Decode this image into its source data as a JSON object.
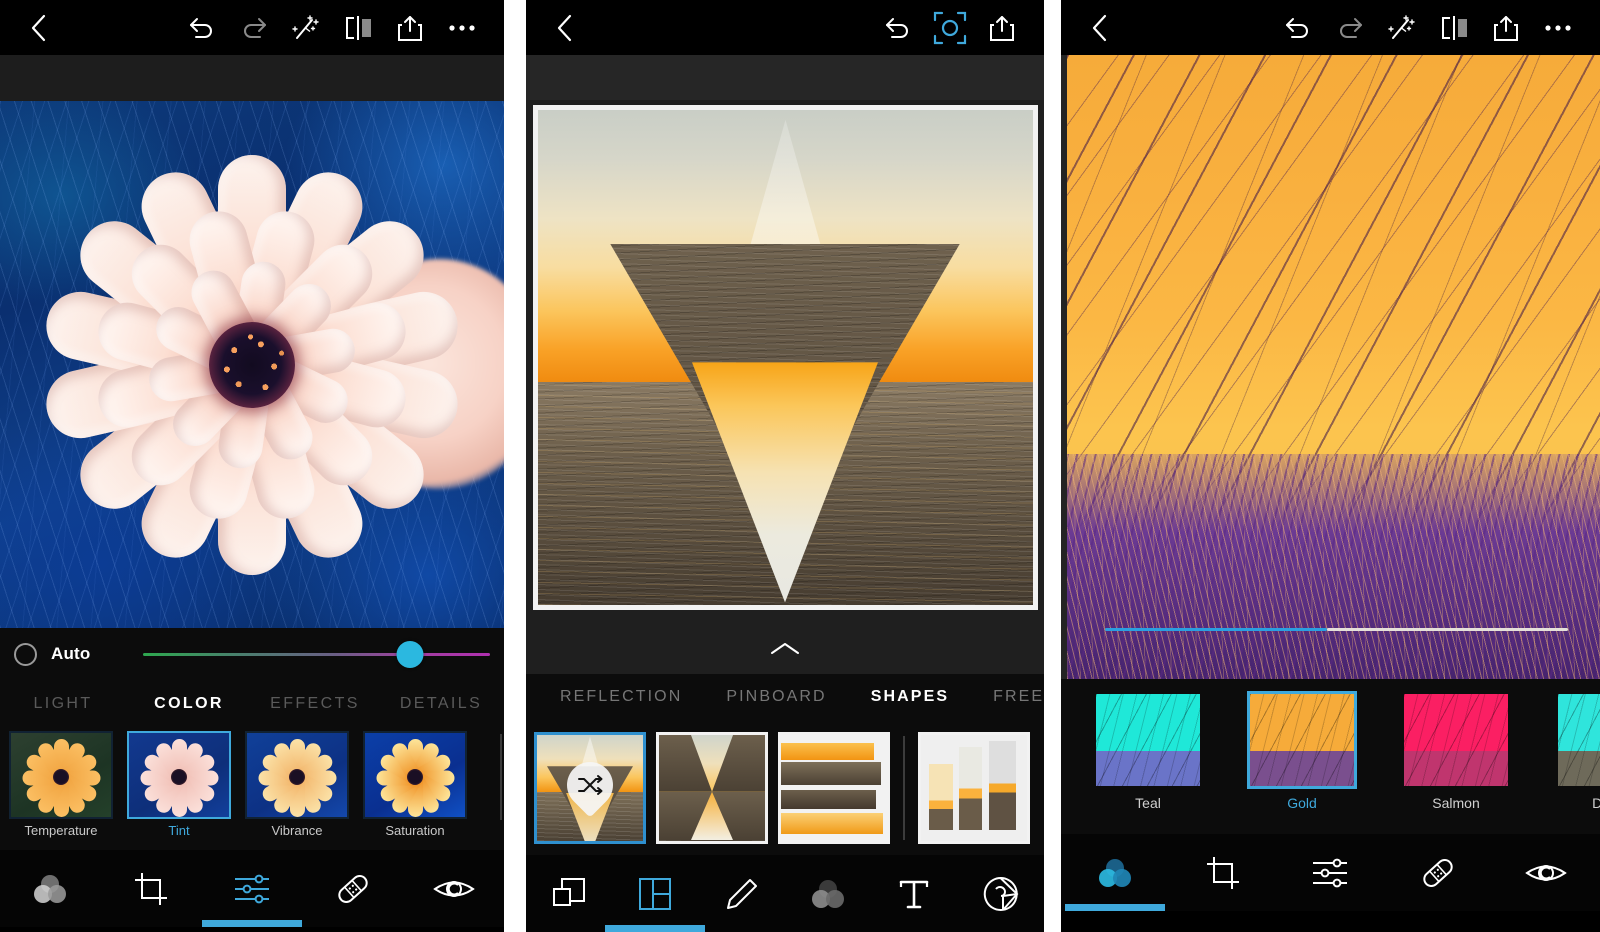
{
  "screens": [
    {
      "id": "adjust-color",
      "topbar": {
        "back_icon": "chevron-left-icon",
        "actions": [
          {
            "icon": "undo-icon",
            "label": "Undo"
          },
          {
            "icon": "redo-icon",
            "label": "Redo"
          },
          {
            "icon": "magic-wand-icon",
            "label": "Auto Enhance"
          },
          {
            "icon": "compare-split-icon",
            "label": "Compare"
          },
          {
            "icon": "share-icon",
            "label": "Share"
          },
          {
            "icon": "more-ellipsis-icon",
            "label": "More"
          }
        ]
      },
      "photo": {
        "subject": "pink dahlia flower on blue background"
      },
      "auto_row": {
        "toggle_icon": "auto-toggle-circle",
        "label": "Auto",
        "slider": {
          "value_percent": 77,
          "type": "tint",
          "from": "green",
          "to": "magenta",
          "thumb_color": "#2bb8e0"
        }
      },
      "adjust_tabs": [
        {
          "label": "LIGHT",
          "active": false
        },
        {
          "label": "COLOR",
          "active": true
        },
        {
          "label": "EFFECTS",
          "active": false
        },
        {
          "label": "DETAILS",
          "active": false
        }
      ],
      "adjustments": [
        {
          "label": "Temperature",
          "selected": false
        },
        {
          "label": "Tint",
          "selected": true
        },
        {
          "label": "Vibrance",
          "selected": false
        },
        {
          "label": "Saturation",
          "selected": false
        }
      ],
      "bottom_nav": [
        {
          "icon": "color-mix-circles-icon",
          "label": "Looks",
          "active": false
        },
        {
          "icon": "crop-icon",
          "label": "Crop",
          "active": false
        },
        {
          "icon": "sliders-icon",
          "label": "Adjust",
          "active": true
        },
        {
          "icon": "bandage-heal-icon",
          "label": "Heal",
          "active": false
        },
        {
          "icon": "eye-red-eye-icon",
          "label": "Red Eye",
          "active": false
        }
      ]
    },
    {
      "id": "collage-shapes",
      "topbar": {
        "back_icon": "chevron-left-icon",
        "actions": [
          {
            "icon": "undo-icon",
            "label": "Undo"
          },
          {
            "icon": "focus-target-icon",
            "label": "Preview",
            "active": true
          },
          {
            "icon": "share-icon",
            "label": "Share"
          }
        ]
      },
      "photo": {
        "subject": "triangle-masked sunset ocean collage"
      },
      "collapse_icon": "chevron-up-icon",
      "tabs": [
        {
          "label": "REFLECTION",
          "active": false
        },
        {
          "label": "PINBOARD",
          "active": false
        },
        {
          "label": "SHAPES",
          "active": true
        },
        {
          "label": "FREEFORMS",
          "active": false
        }
      ],
      "shape_thumbs": [
        {
          "name": "shape-shuffle",
          "selected": true,
          "badge_icon": "shuffle-icon"
        },
        {
          "name": "shape-hourglass",
          "selected": false
        },
        {
          "name": "shape-bands",
          "selected": false
        },
        {
          "name": "shape-columns",
          "selected": false
        }
      ],
      "bottom_nav": [
        {
          "icon": "layers-icon",
          "label": "Layers",
          "active": false
        },
        {
          "icon": "grid-collage-icon",
          "label": "Collage",
          "active": true
        },
        {
          "icon": "pencil-draw-icon",
          "label": "Draw",
          "active": false
        },
        {
          "icon": "color-mix-circles-icon",
          "label": "Looks",
          "active": false
        },
        {
          "icon": "text-t-icon",
          "label": "Text",
          "active": false
        },
        {
          "icon": "sticker-icon",
          "label": "Sticker",
          "active": false
        }
      ]
    },
    {
      "id": "looks-presets",
      "topbar": {
        "back_icon": "chevron-left-icon",
        "actions": [
          {
            "icon": "undo-icon",
            "label": "Undo"
          },
          {
            "icon": "redo-icon",
            "label": "Redo"
          },
          {
            "icon": "magic-wand-icon",
            "label": "Auto Enhance"
          },
          {
            "icon": "compare-split-icon",
            "label": "Compare"
          },
          {
            "icon": "share-icon",
            "label": "Share"
          },
          {
            "icon": "more-ellipsis-icon",
            "label": "More"
          }
        ]
      },
      "photo": {
        "subject": "beach grass at golden sunset"
      },
      "slider": {
        "value_percent": 48,
        "fill_color": "#2b9fe0",
        "rest_color": "#e5e0da",
        "thumb_color": "#2bb8e0"
      },
      "presets": [
        {
          "label": "Teal",
          "selected": false,
          "sky": "#1fe8d8",
          "grass": "#6a74c8"
        },
        {
          "label": "Gold",
          "selected": true,
          "sky": "#f6ab3a",
          "grass": "#7a4f8e"
        },
        {
          "label": "Salmon",
          "selected": false,
          "sky": "#fb1f63",
          "grass": "#c0356e"
        },
        {
          "label": "Dawn",
          "selected": false,
          "sky": "#2fe5dc",
          "grass": "#6e6a5a"
        }
      ],
      "bottom_nav": [
        {
          "icon": "color-mix-circles-icon",
          "label": "Looks",
          "active": true
        },
        {
          "icon": "crop-icon",
          "label": "Crop",
          "active": false
        },
        {
          "icon": "sliders-icon",
          "label": "Adjust",
          "active": false
        },
        {
          "icon": "bandage-heal-icon",
          "label": "Heal",
          "active": false
        },
        {
          "icon": "eye-red-eye-icon",
          "label": "Red Eye",
          "active": false
        }
      ]
    }
  ],
  "theme": {
    "accent": "#3fa9dc",
    "thumb": "#2bb8e0",
    "bg_dark": "#0c0c0c",
    "bg_black": "#000000"
  }
}
